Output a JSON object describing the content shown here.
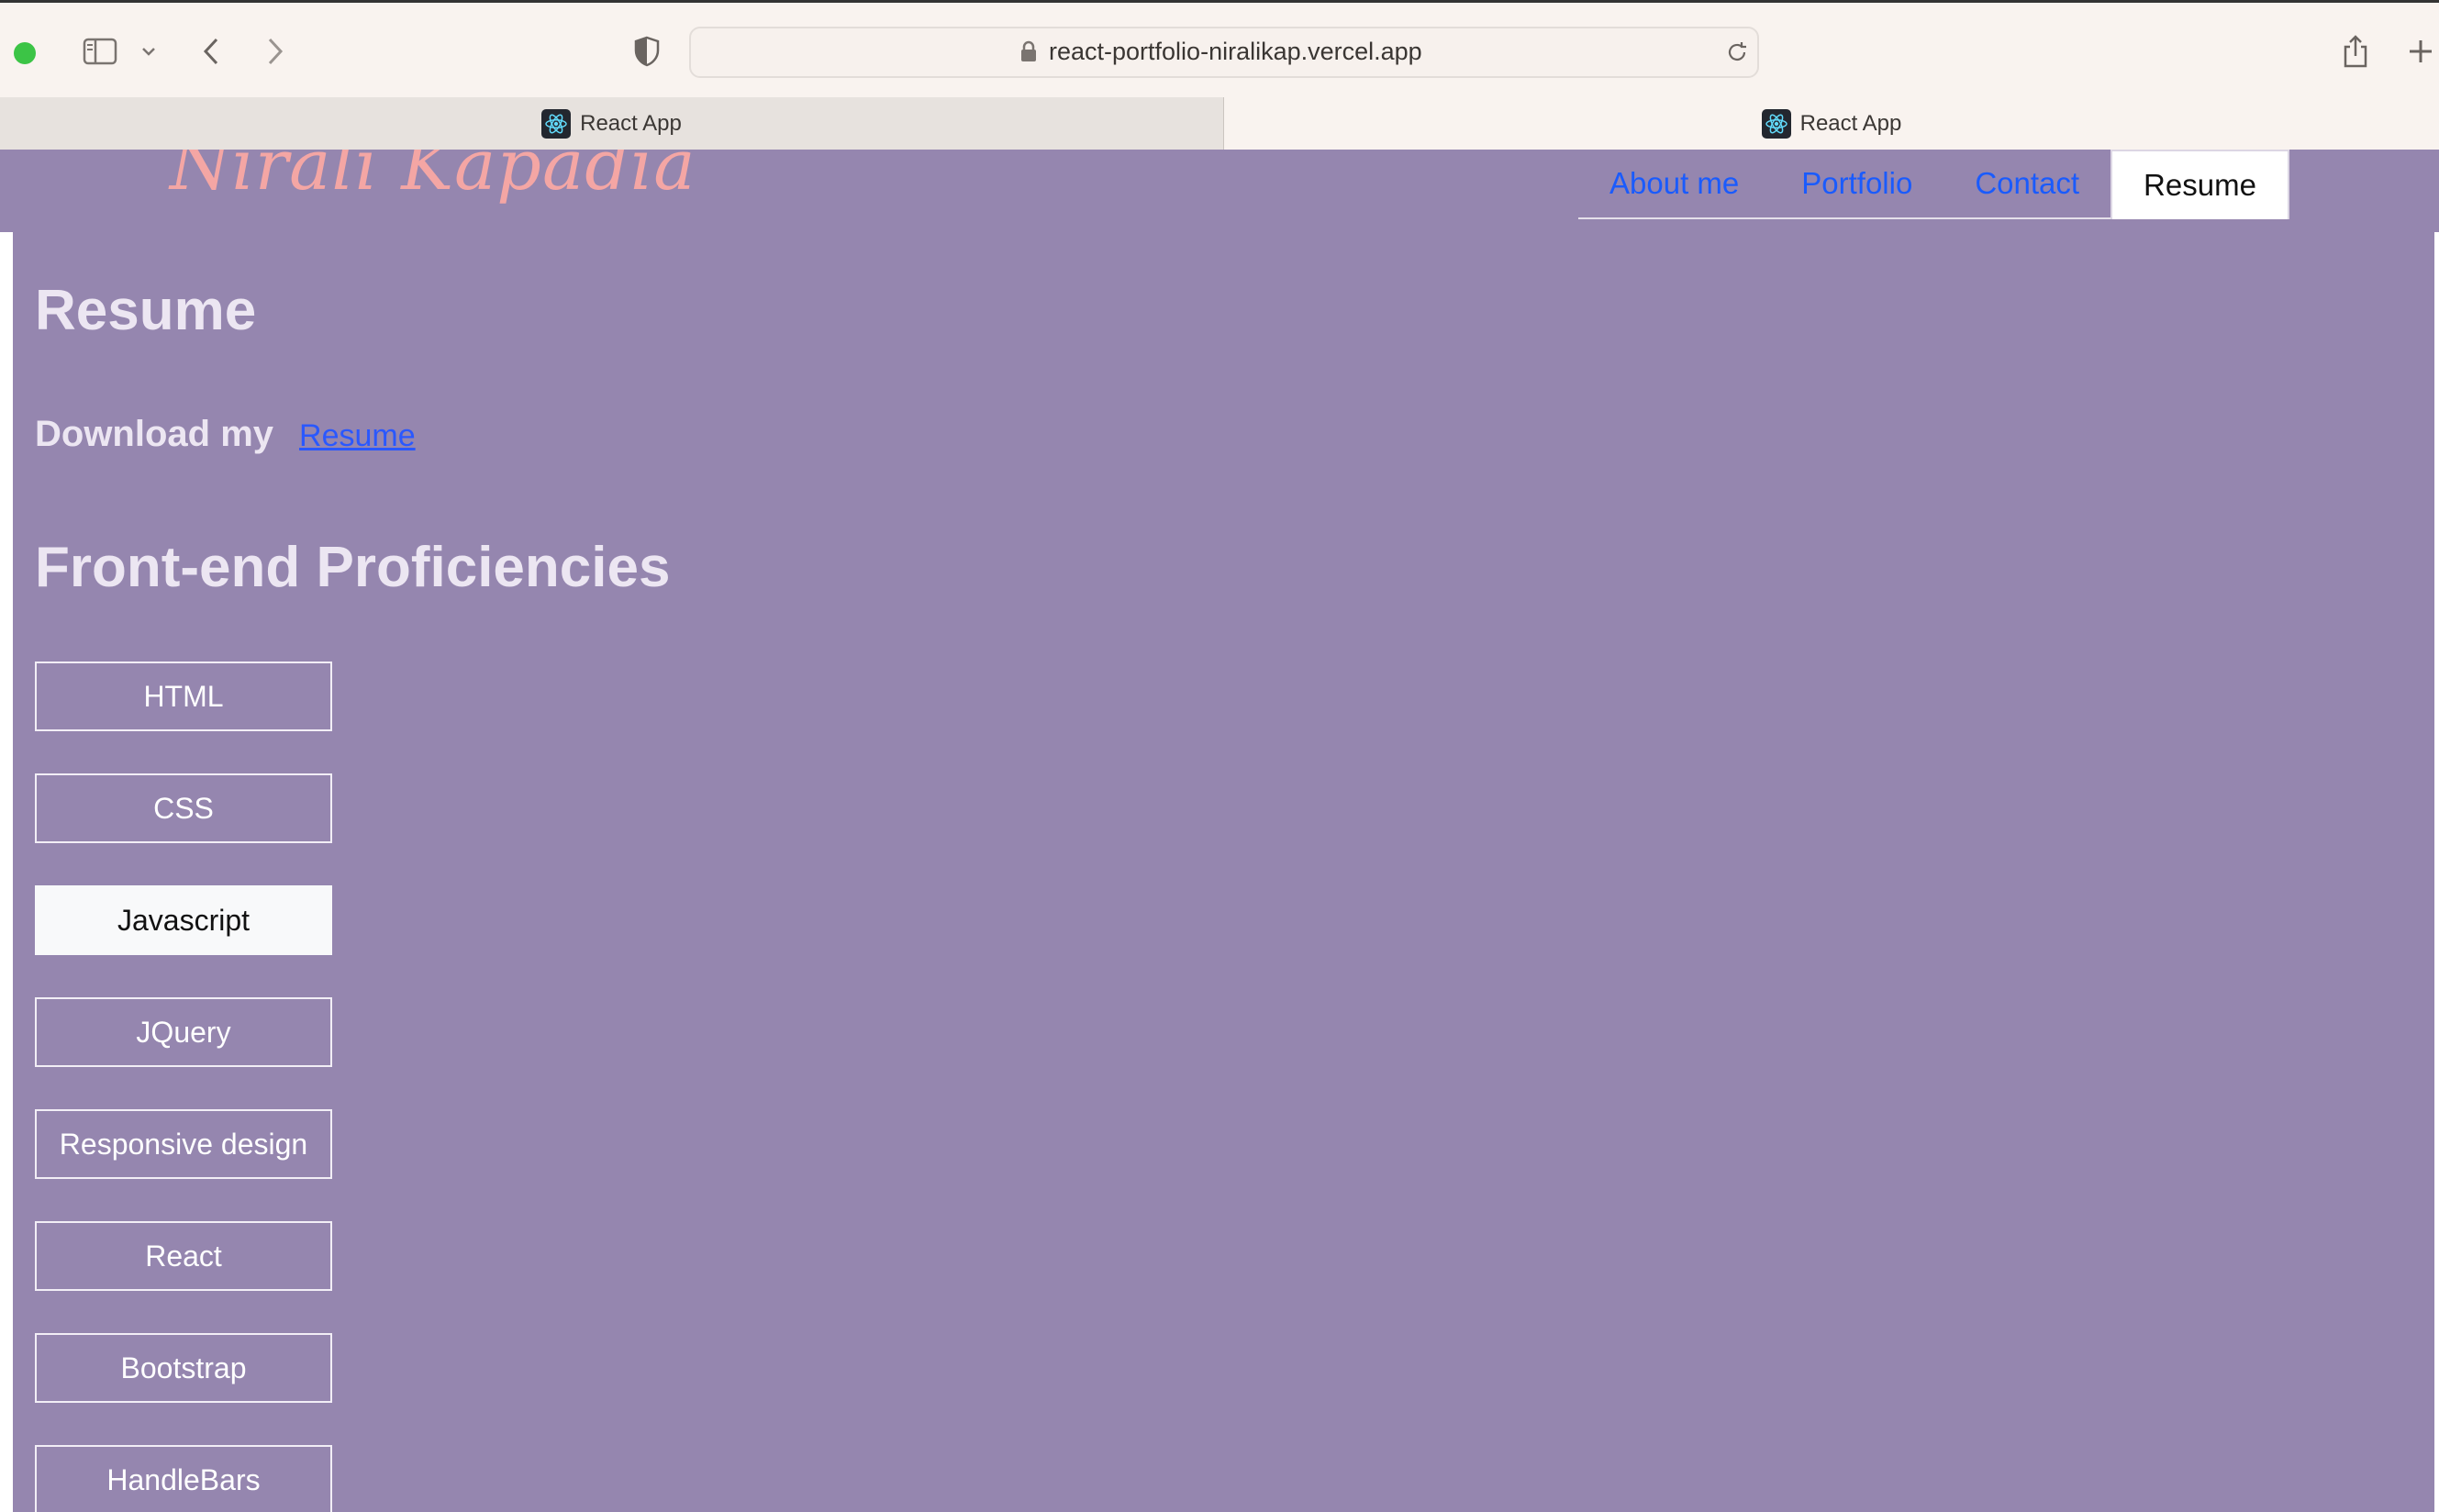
{
  "browser": {
    "url": "react-portfolio-niralikap.vercel.app",
    "tabs": [
      {
        "title": "React App"
      },
      {
        "title": "React App"
      }
    ],
    "icons": {
      "sidebar": "sidebar-icon",
      "sidebar_menu": "chevron-down-icon",
      "back": "chevron-left-icon",
      "forward": "chevron-right-icon",
      "privacy": "shield-icon",
      "lock": "lock-icon",
      "reload": "reload-icon",
      "share": "share-icon",
      "new_tab": "plus-icon",
      "favicon": "react-logo-icon"
    }
  },
  "site": {
    "brand": "Nirali Kapadia",
    "nav": [
      {
        "label": "About me"
      },
      {
        "label": "Portfolio"
      },
      {
        "label": "Contact"
      },
      {
        "label": "Resume"
      }
    ],
    "active_nav": "Resume"
  },
  "resume": {
    "heading": "Resume",
    "download_text": "Download my",
    "download_link": "Resume",
    "proficiencies_heading": "Front-end Proficiencies",
    "skills": [
      {
        "label": "HTML"
      },
      {
        "label": "CSS"
      },
      {
        "label": "Javascript"
      },
      {
        "label": "JQuery"
      },
      {
        "label": "Responsive design"
      },
      {
        "label": "React"
      },
      {
        "label": "Bootstrap"
      },
      {
        "label": "HandleBars"
      }
    ],
    "selected_skill": "Javascript"
  },
  "colors": {
    "page_bg": "#9586af",
    "brand": "#f4a6a4",
    "link": "#1a5bfd",
    "heading": "#ece6f2"
  }
}
